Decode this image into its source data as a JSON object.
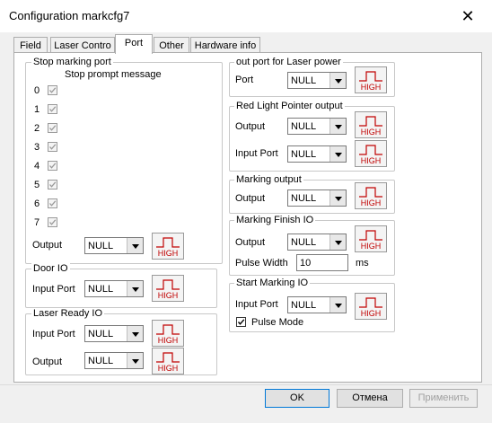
{
  "window": {
    "title": "Configuration markcfg7",
    "close_glyph": "✕"
  },
  "tabs": [
    "Field",
    "Laser Contro",
    "Port",
    "Other",
    "Hardware info"
  ],
  "active_tab": "Port",
  "high_label": "HIGH",
  "null_value": "NULL",
  "stop_marking": {
    "legend": "Stop marking port",
    "prompt_header": "Stop prompt message",
    "ports": [
      "0",
      "1",
      "2",
      "3",
      "4",
      "5",
      "6",
      "7"
    ],
    "output_label": "Output",
    "output_value": "NULL"
  },
  "door_io": {
    "legend": "Door IO",
    "input_label": "Input Port",
    "input_value": "NULL"
  },
  "laser_ready": {
    "legend": "Laser Ready IO",
    "input_label": "Input Port",
    "input_value": "NULL",
    "output_label": "Output",
    "output_value": "NULL"
  },
  "laser_power": {
    "legend": "out port for Laser power",
    "port_label": "Port",
    "port_value": "NULL"
  },
  "red_light": {
    "legend": "Red Light Pointer output",
    "output_label": "Output",
    "output_value": "NULL",
    "input_label": "Input Port",
    "input_value": "NULL"
  },
  "marking_output": {
    "legend": "Marking output",
    "output_label": "Output",
    "output_value": "NULL"
  },
  "marking_finish": {
    "legend": "Marking Finish IO",
    "output_label": "Output",
    "output_value": "NULL",
    "pulse_label": "Pulse Width",
    "pulse_value": "10",
    "pulse_unit": "ms"
  },
  "start_marking": {
    "legend": "Start Marking IO",
    "input_label": "Input Port",
    "input_value": "NULL",
    "pulse_mode_label": "Pulse Mode",
    "pulse_mode_checked": true
  },
  "buttons": {
    "ok": "OK",
    "cancel": "Отмена",
    "apply": "Применить"
  }
}
